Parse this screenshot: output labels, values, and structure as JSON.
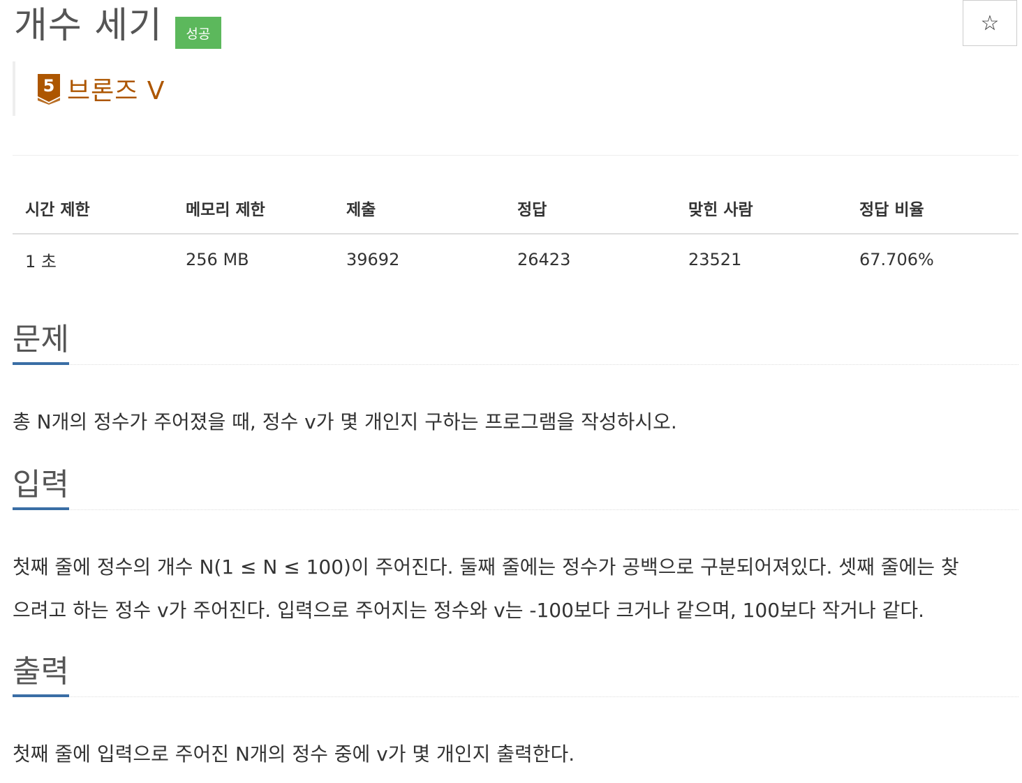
{
  "problem": {
    "title": "개수 세기",
    "status_badge": "성공",
    "tier": {
      "level": "5",
      "name": "브론즈 V",
      "color": "#ad5600"
    },
    "star_icon": "☆"
  },
  "stats": {
    "headers": [
      "시간 제한",
      "메모리 제한",
      "제출",
      "정답",
      "맞힌 사람",
      "정답 비율"
    ],
    "values": [
      "1 초",
      "256 MB",
      "39692",
      "26423",
      "23521",
      "67.706%"
    ]
  },
  "sections": {
    "description": {
      "title": "문제",
      "text": "총 N개의 정수가 주어졌을 때, 정수 v가 몇 개인지 구하는 프로그램을 작성하시오."
    },
    "input": {
      "title": "입력",
      "line1": "첫째 줄에 정수의 개수 N(1 ≤ N ≤ 100)이 주어진다. 둘째 줄에는 정수가 공백으로 구분되어져있다. 셋째 줄에는 찾",
      "line2": "으려고 하는 정수 v가 주어진다. 입력으로 주어지는 정수와 v는 -100보다 크거나 같으며, 100보다 작거나 같다."
    },
    "output": {
      "title": "출력",
      "text": "첫째 줄에 입력으로 주어진 N개의 정수 중에 v가 몇 개인지 출력한다."
    }
  },
  "colors": {
    "success": "#5cb85c",
    "bronze": "#ad5600",
    "section_underline": "#3a6ea5"
  }
}
